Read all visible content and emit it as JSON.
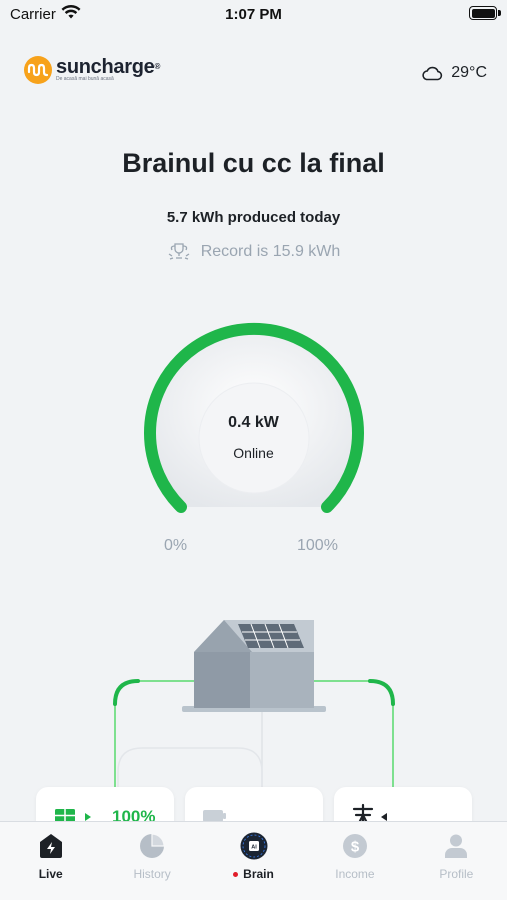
{
  "status_bar": {
    "carrier": "Carrier",
    "time": "1:07 PM"
  },
  "header": {
    "logo_name": "suncharge",
    "logo_reg": "®",
    "logo_tagline": "De acasă mai bună acasă",
    "weather": {
      "icon": "cloud-icon",
      "temperature": "29°C"
    }
  },
  "site": {
    "title": "Brainul cu cc la final",
    "produced": "5.7 kWh produced today",
    "record": "Record is 15.9 kWh"
  },
  "gauge": {
    "value": "0.4 kW",
    "status": "Online",
    "min_label": "0%",
    "max_label": "100%"
  },
  "flow_cards": {
    "solar": {
      "icon": "solar-panel-icon",
      "percent": "100%"
    },
    "battery": {
      "icon": "battery-icon"
    },
    "grid": {
      "icon": "power-tower-icon"
    }
  },
  "tabs": [
    {
      "label": "Live",
      "icon": "live-bolt-icon",
      "active": true
    },
    {
      "label": "History",
      "icon": "pie-chart-icon",
      "active": false
    },
    {
      "label": "Brain",
      "icon": "ai-chip-icon",
      "active": false
    },
    {
      "label": "Income",
      "icon": "dollar-icon",
      "active": false
    },
    {
      "label": "Profile",
      "icon": "user-icon",
      "active": false
    }
  ],
  "colors": {
    "accent_green": "#1fb64a",
    "light_green": "#7ee08f",
    "background": "#f1f3f5",
    "muted_text": "#9aa5b1",
    "brand_orange": "#f7a21b"
  }
}
